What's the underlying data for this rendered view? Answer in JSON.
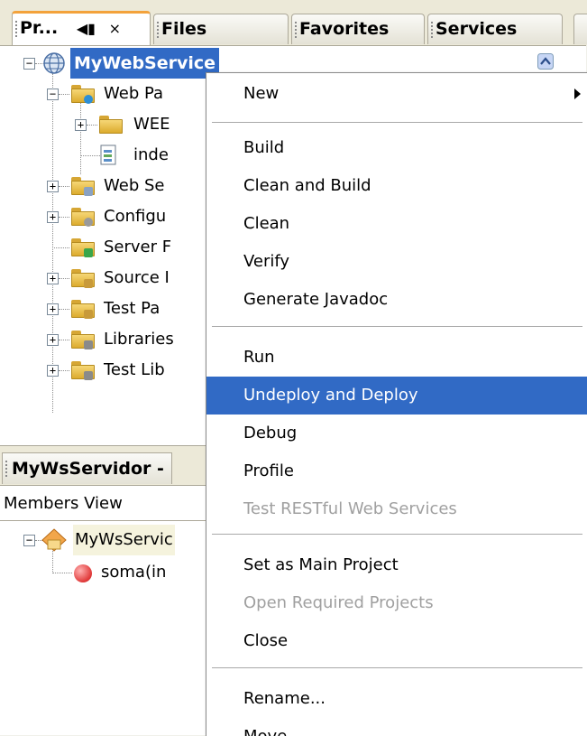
{
  "tabs": [
    {
      "label": "Pr...",
      "active": true
    },
    {
      "label": "Files",
      "active": false
    },
    {
      "label": "Favorites",
      "active": false
    },
    {
      "label": "Services",
      "active": false
    }
  ],
  "tab_controls": {
    "pin": "◀▮",
    "close": "×"
  },
  "project_tree": {
    "root": "MyWebService",
    "nodes": [
      {
        "label": "Web Pa"
      },
      {
        "label": "WEE"
      },
      {
        "label": "inde"
      },
      {
        "label": "Web Se"
      },
      {
        "label": "Configu"
      },
      {
        "label": "Server F"
      },
      {
        "label": "Source I"
      },
      {
        "label": "Test Pa"
      },
      {
        "label": "Libraries"
      },
      {
        "label": "Test Lib"
      }
    ]
  },
  "navigator": {
    "title": "MyWsServidor -",
    "view_selector": "Members View",
    "root": "MyWsServic",
    "method": "soma(in"
  },
  "context_menu": {
    "items": [
      {
        "label": "New",
        "submenu": true,
        "disabled": false,
        "highlighted": false
      },
      {
        "label": "Build",
        "disabled": false,
        "highlighted": false
      },
      {
        "label": "Clean and Build",
        "disabled": false,
        "highlighted": false
      },
      {
        "label": "Clean",
        "disabled": false,
        "highlighted": false
      },
      {
        "label": "Verify",
        "disabled": false,
        "highlighted": false
      },
      {
        "label": "Generate Javadoc",
        "disabled": false,
        "highlighted": false
      },
      {
        "label": "Run",
        "disabled": false,
        "highlighted": false
      },
      {
        "label": "Undeploy and Deploy",
        "disabled": false,
        "highlighted": true
      },
      {
        "label": "Debug",
        "disabled": false,
        "highlighted": false
      },
      {
        "label": "Profile",
        "disabled": false,
        "highlighted": false
      },
      {
        "label": "Test RESTful Web Services",
        "disabled": true,
        "highlighted": false
      },
      {
        "label": "Set as Main Project",
        "disabled": false,
        "highlighted": false
      },
      {
        "label": "Open Required Projects",
        "disabled": true,
        "highlighted": false
      },
      {
        "label": "Close",
        "disabled": false,
        "highlighted": false
      },
      {
        "label": "Rename...",
        "disabled": false,
        "highlighted": false
      },
      {
        "label": "Move...",
        "disabled": false,
        "highlighted": false
      }
    ]
  },
  "colors": {
    "selection": "#316ac5",
    "active_tab_accent": "#f3a23b",
    "disabled_text": "#a0a0a0"
  }
}
